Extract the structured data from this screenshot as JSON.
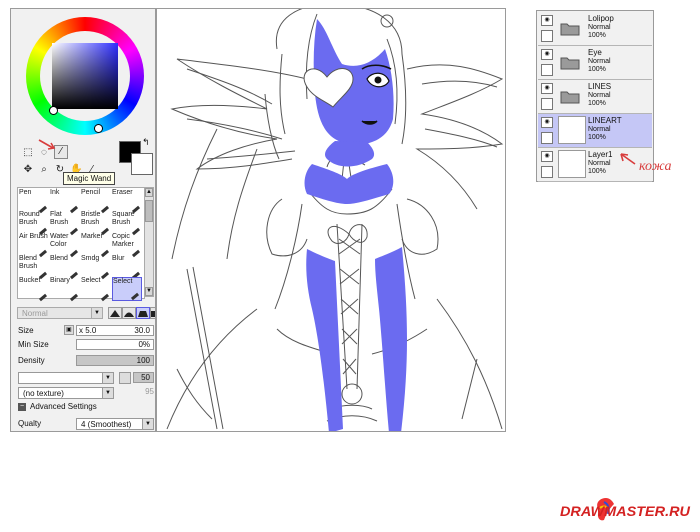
{
  "tool_panel": {
    "tooltip": "Magic Wand",
    "brushes": [
      {
        "label": "Pen"
      },
      {
        "label": "Ink"
      },
      {
        "label": "Pencil"
      },
      {
        "label": "Eraser"
      },
      {
        "label": "Round Brush"
      },
      {
        "label": "Flat Brush"
      },
      {
        "label": "Bristle Brush"
      },
      {
        "label": "Square Brush"
      },
      {
        "label": "Air Brush"
      },
      {
        "label": "Water Color"
      },
      {
        "label": "Marker"
      },
      {
        "label": "Copic Marker"
      },
      {
        "label": "Blend Brush"
      },
      {
        "label": "Blend"
      },
      {
        "label": "Smdg"
      },
      {
        "label": "Blur"
      },
      {
        "label": "Bucket"
      },
      {
        "label": "Binary"
      },
      {
        "label": "Select"
      },
      {
        "label": "Select"
      }
    ],
    "selected_brush_index": 19,
    "blend_mode": "Normal",
    "size_label": "Size",
    "size_multiplier": "x 5.0",
    "size_value": "30.0",
    "min_size_label": "Min Size",
    "min_size_value": "0%",
    "density_label": "Density",
    "density_value": "100",
    "blending_value": "50",
    "texture": "(no texture)",
    "texture_value": "95",
    "advanced_label": "Advanced Settings",
    "quality_label": "Qualty",
    "quality_value": "4 (Smoothest)"
  },
  "colors": {
    "foreground": "#000000",
    "background": "#ffffff",
    "fill_highlight": "#6b6bf0",
    "selected_layer": "#c5c7f6",
    "annotation_red": "#d83c3c"
  },
  "layers": [
    {
      "name": "Lolipop",
      "mode": "Normal",
      "opacity": "100%",
      "type": "folder",
      "selected": false
    },
    {
      "name": "Eye",
      "mode": "Normal",
      "opacity": "100%",
      "type": "folder",
      "selected": false
    },
    {
      "name": "LINES",
      "mode": "Normal",
      "opacity": "100%",
      "type": "folder",
      "selected": false
    },
    {
      "name": "LINEART",
      "mode": "Normal",
      "opacity": "100%",
      "type": "layer",
      "selected": true
    },
    {
      "name": "Layer1",
      "mode": "Normal",
      "opacity": "100%",
      "type": "layer",
      "selected": false
    }
  ],
  "annotation": {
    "label": "кожа"
  },
  "watermark": {
    "text": "DRAWMASTER.RU"
  }
}
